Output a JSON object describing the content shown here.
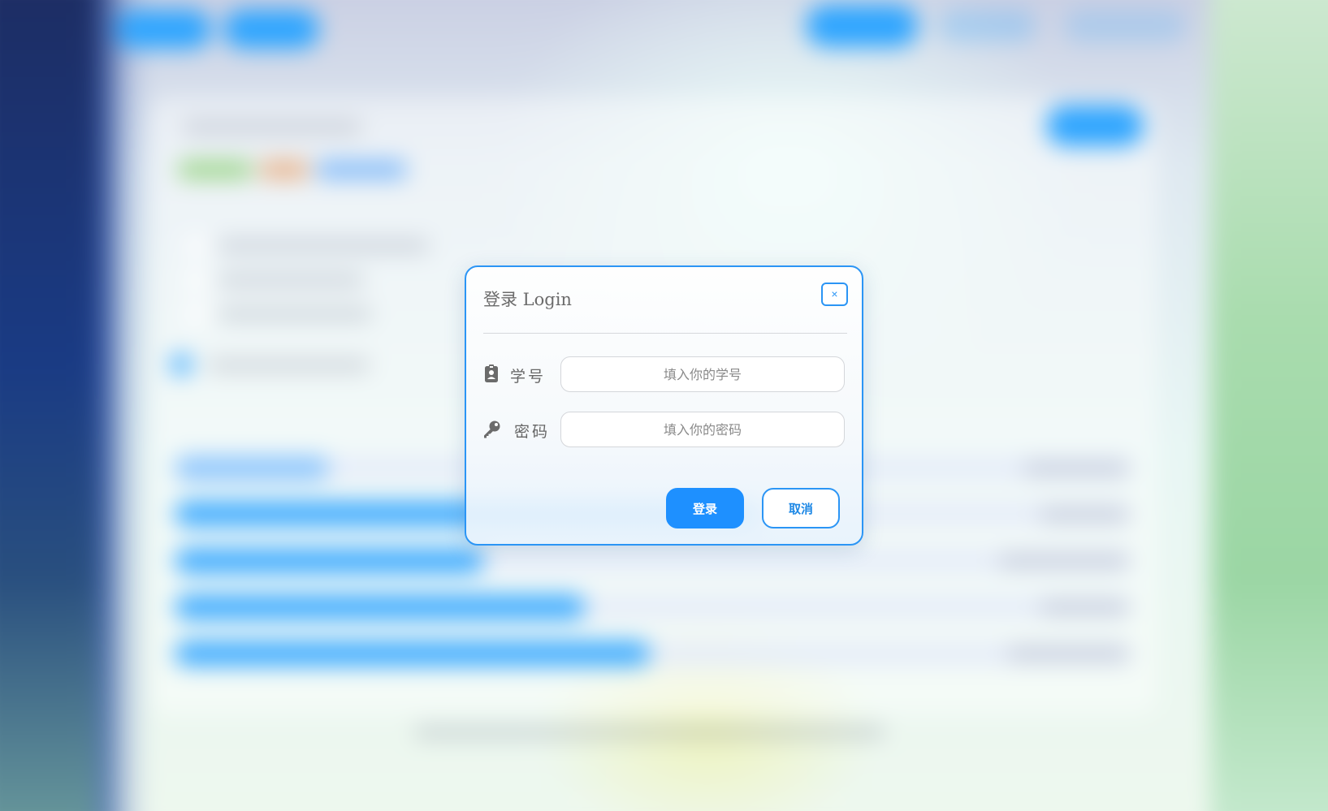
{
  "modal": {
    "title": "登录 Login",
    "close_label": "×",
    "fields": [
      {
        "label": "学号",
        "placeholder": "填入你的学号",
        "value": "",
        "icon": "id-badge-icon"
      },
      {
        "label": "密码",
        "placeholder": "填入你的密码",
        "value": "",
        "icon": "key-icon"
      }
    ],
    "submit_label": "登录",
    "cancel_label": "取消"
  },
  "colors": {
    "accent": "#1e90ff",
    "border": "#2b95f5",
    "label_text": "#666666"
  }
}
